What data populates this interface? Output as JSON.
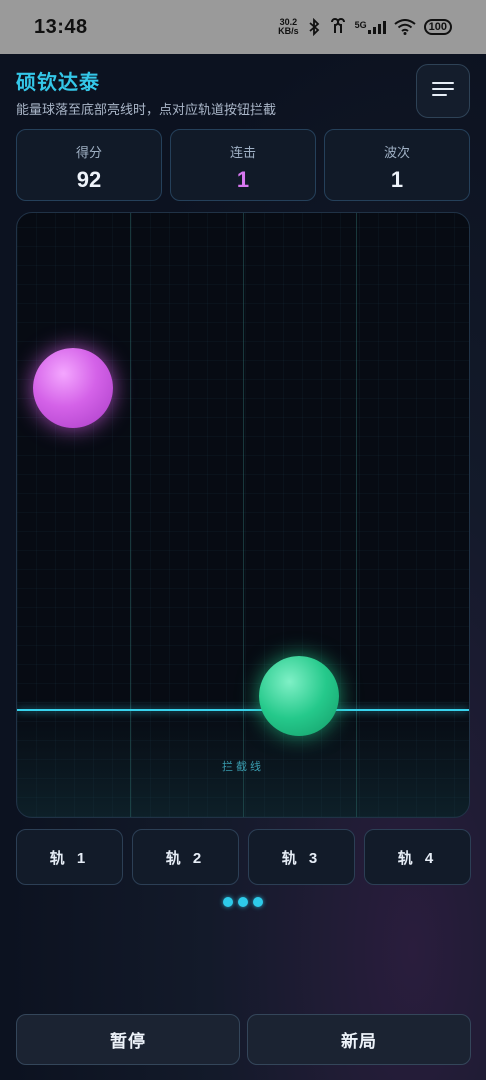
{
  "status_bar": {
    "time": "13:48",
    "net_speed_value": "30.2",
    "net_speed_unit": "KB/s",
    "network": "5G",
    "battery": "100"
  },
  "header": {
    "title": "硕钦达泰",
    "subtitle": "能量球落至底部亮线时，点对应轨道按钮拦截",
    "menu_icon": "menu-icon"
  },
  "stats": [
    {
      "label": "得分",
      "value": "92"
    },
    {
      "label": "连击",
      "value": "1"
    },
    {
      "label": "波次",
      "value": "1"
    }
  ],
  "board": {
    "intercept_label": "拦截线",
    "orbs": [
      {
        "color": "pink",
        "lane": 1
      },
      {
        "color": "green",
        "lane": 3
      }
    ]
  },
  "lanes": [
    "轨 1",
    "轨 2",
    "轨 3",
    "轨 4"
  ],
  "pager_dots": 3,
  "actions": {
    "pause_label": "暂停",
    "new_game_label": "新局"
  },
  "colors": {
    "accent": "#34c7e8",
    "combo": "#d778f0",
    "orb_pink": "#d462e8",
    "orb_green": "#25c98b"
  }
}
